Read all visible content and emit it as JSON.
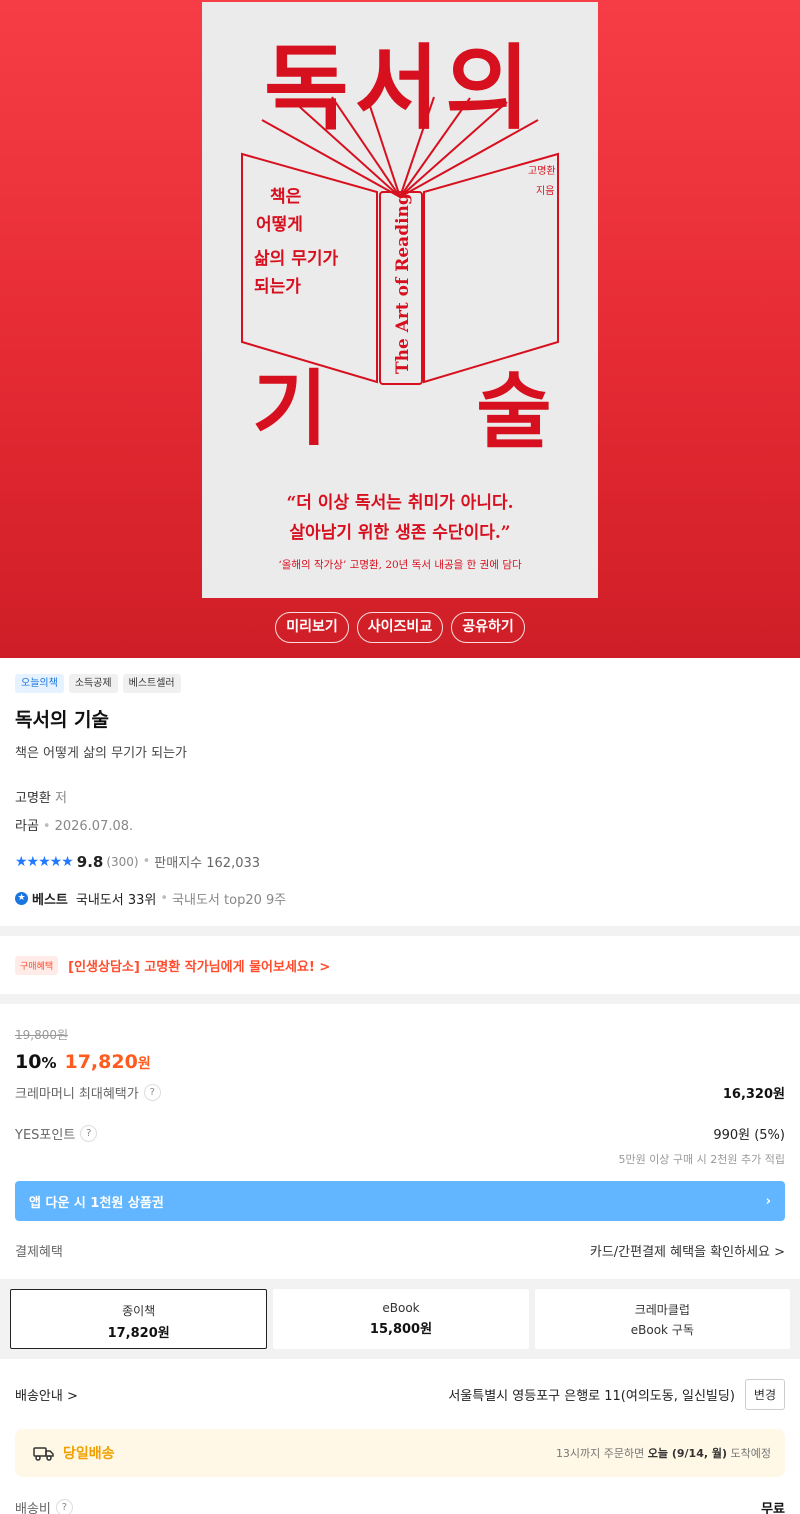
{
  "cover": {
    "title_top": "독서의",
    "title_bottom_left": "기",
    "title_bottom_right": "술",
    "tagline_lines": [
      "책은",
      "어떻게",
      "삶의 무기가",
      "되는가"
    ],
    "spine_text": "The Art of Reading",
    "author_vertical": [
      "고명환",
      "지음"
    ],
    "quote_line1": "“더 이상 독서는 취미가 아니다.",
    "quote_line2": "살아남기 위한 생존 수단이다.”",
    "quote_sub": "‘올해의 작가상’ 고명환, 20년 독서 내공을 한 권에 담다"
  },
  "hero_buttons": [
    "미리보기",
    "사이즈비교",
    "공유하기"
  ],
  "tags": [
    "오늘의책",
    "소득공제",
    "베스트셀러"
  ],
  "product": {
    "title": "독서의 기술",
    "subtitle": "책은 어떻게 삶의 무기가 되는가",
    "author": "고명환",
    "author_role": "저",
    "publisher": "라곰",
    "date": "2026.07.08."
  },
  "rating": {
    "stars": "★★★★★",
    "score": "9.8",
    "count": "(300)",
    "sales_label": "판매지수 162,033"
  },
  "best": {
    "badge": "★",
    "label": "베스트",
    "rank": "국내도서 33위",
    "weeks": "국내도서 top20 9주"
  },
  "benefit": {
    "badge": "구매혜택",
    "text": "[인생상담소] 고명환 작가님에게 물어보세요! >"
  },
  "price": {
    "original": "19,800원",
    "discount": "10",
    "discount_unit": "%",
    "sale": "17,820",
    "sale_unit": "원",
    "crema_label": "크레마머니 최대혜택가",
    "crema_value": "16,320원",
    "point_label": "YES포인트",
    "point_value": "990원 (5%)",
    "point_note": "5만원 이상 구매 시 2천원 추가 적립",
    "app_banner": "앱 다운 시 1천원 상품권",
    "pay_label": "결제혜택",
    "pay_link": "카드/간편결제 혜택을 확인하세요 >"
  },
  "formats": [
    {
      "name": "종이책",
      "price": "17,820원"
    },
    {
      "name": "eBook",
      "price": "15,800원"
    },
    {
      "name": "크레마클럽",
      "price": "eBook 구독"
    }
  ],
  "shipping": {
    "label": "배송안내 >",
    "address": "서울특별시 영등포구 은행로 11(여의도동, 일신빌딩)",
    "change_btn": "변경",
    "sameday": "당일배송",
    "deadline_pre": "13시까지 주문하면 ",
    "deadline_day": "오늘 (9/14, 월)",
    "deadline_post": " 도착예정",
    "fee_label": "배송비",
    "fee_value": "무료"
  },
  "colors": {
    "hero_red": "#e52a33",
    "cover_red": "#d7101f",
    "accent_orange": "#ff5a1f",
    "link_blue": "#1a75e0",
    "app_banner": "#62b6ff",
    "sameday_bg": "#fff8e6"
  }
}
